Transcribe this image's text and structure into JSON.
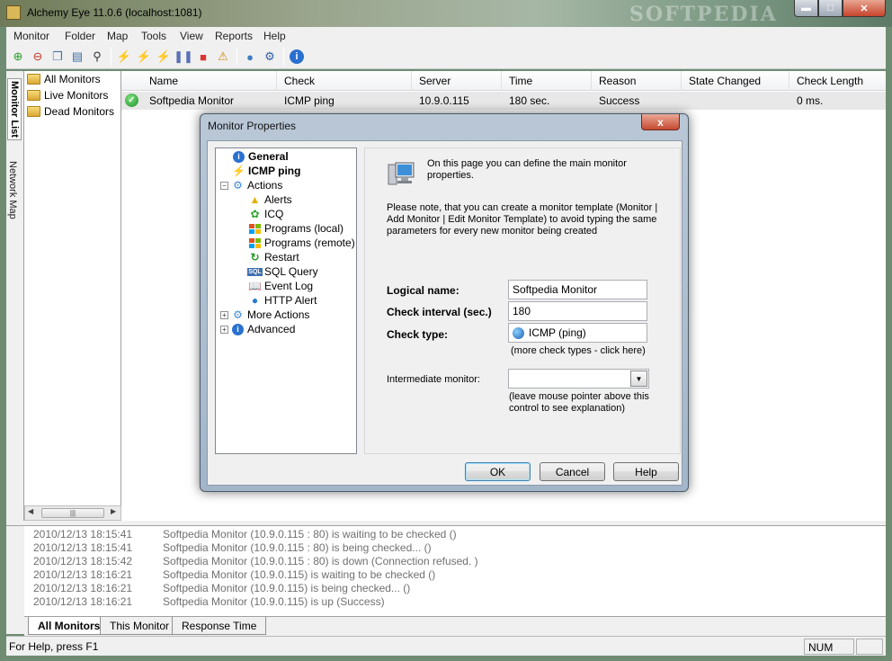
{
  "window": {
    "title": "Alchemy Eye 11.0.6 (localhost:1081)",
    "watermark": "SOFTPEDIA"
  },
  "menu": [
    "Monitor",
    "Folder",
    "Map",
    "Tools",
    "View",
    "Reports",
    "Help"
  ],
  "toolbar": {
    "icons": [
      "add-monitor-icon",
      "remove-monitor-icon",
      "copy-monitor-icon",
      "monitor-properties-icon",
      "find-icon",
      "check-now-icon",
      "check-all-icon",
      "stop-check-icon",
      "pause-icon",
      "stop-icon",
      "alert-icon",
      "network-icon",
      "network-scan-icon",
      "about-icon"
    ]
  },
  "sidebar": {
    "tabs": [
      "Monitor List",
      "Network Map"
    ],
    "items": [
      "All Monitors",
      "Live Monitors",
      "Dead Monitors"
    ]
  },
  "list": {
    "columns": [
      "Name",
      "Check",
      "Server",
      "Time",
      "Reason",
      "State Changed",
      "Check Length"
    ],
    "rows": [
      {
        "name": "Softpedia Monitor",
        "check": "ICMP ping",
        "server": "10.9.0.115",
        "time": "180 sec.",
        "reason": "Success",
        "state_changed": "",
        "check_length": "0 ms."
      }
    ]
  },
  "log": {
    "entries": [
      {
        "time": "2010/12/13 18:15:41",
        "message": "Softpedia Monitor (10.9.0.115 : 80) is waiting to be checked ()"
      },
      {
        "time": "2010/12/13 18:15:41",
        "message": "Softpedia Monitor (10.9.0.115 : 80) is being checked... ()"
      },
      {
        "time": "2010/12/13 18:15:42",
        "message": "Softpedia Monitor (10.9.0.115 : 80) is down (Connection refused. )"
      },
      {
        "time": "2010/12/13 18:16:21",
        "message": "Softpedia Monitor (10.9.0.115) is waiting to be checked ()"
      },
      {
        "time": "2010/12/13 18:16:21",
        "message": "Softpedia Monitor (10.9.0.115) is being checked... ()"
      },
      {
        "time": "2010/12/13 18:16:21",
        "message": "Softpedia Monitor (10.9.0.115) is up (Success)"
      }
    ],
    "tabs": [
      "All Monitors",
      "This Monitor",
      "Response Time"
    ]
  },
  "statusbar": {
    "text": "For Help, press F1",
    "num": "NUM"
  },
  "dialog": {
    "title": "Monitor Properties",
    "close_label": "x",
    "tree": [
      {
        "label": "General",
        "icon": "info-icon",
        "bold": true
      },
      {
        "label": "ICMP ping",
        "icon": "lightning-icon",
        "bold": true
      },
      {
        "label": "Actions",
        "icon": "actions-icon",
        "bold": false
      },
      {
        "label": "Alerts",
        "icon": "alert-folder-icon",
        "bold": false
      },
      {
        "label": "ICQ",
        "icon": "icq-icon",
        "bold": false
      },
      {
        "label": "Programs (local)",
        "icon": "windows-icon",
        "bold": false
      },
      {
        "label": "Programs (remote)",
        "icon": "windows-icon",
        "bold": false
      },
      {
        "label": "Restart",
        "icon": "restart-icon",
        "bold": false
      },
      {
        "label": "SQL Query",
        "icon": "sql-icon",
        "bold": false
      },
      {
        "label": "Event Log",
        "icon": "book-icon",
        "bold": false
      },
      {
        "label": "HTTP Alert",
        "icon": "globe-icon",
        "bold": false
      },
      {
        "label": "More Actions",
        "icon": "actions-icon",
        "bold": false
      },
      {
        "label": "Advanced",
        "icon": "info-icon",
        "bold": false
      }
    ],
    "intro_text": "On this page you can define the main monitor properties.",
    "note_text": "Please note, that you can create a monitor template (Monitor | Add Monitor | Edit Monitor Template) to avoid typing the same parameters for every new monitor being created",
    "fields": {
      "logical_name_label": "Logical name:",
      "logical_name_value": "Softpedia Monitor",
      "check_interval_label": "Check interval (sec.)",
      "check_interval_value": "180",
      "check_type_label": "Check type:",
      "check_type_value": "ICMP (ping)",
      "check_type_hint": "(more check types - click here)",
      "intermediate_label": "Intermediate monitor:",
      "intermediate_value": "",
      "intermediate_hint": "(leave mouse pointer above this control to see explanation)"
    },
    "buttons": {
      "ok": "OK",
      "cancel": "Cancel",
      "help": "Help"
    }
  }
}
